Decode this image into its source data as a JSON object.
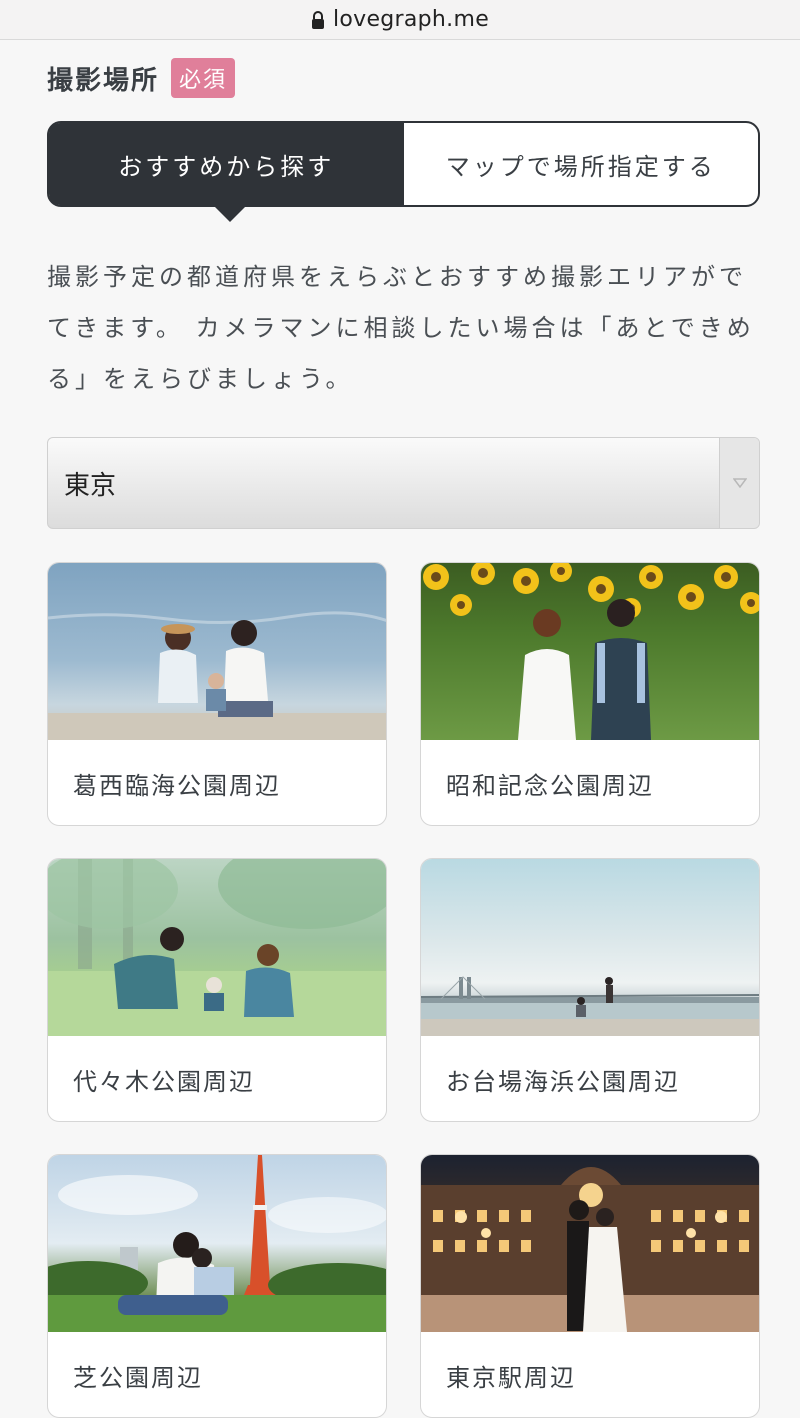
{
  "browser": {
    "url": "lovegraph.me",
    "lock_icon": "lock-icon"
  },
  "section": {
    "title": "撮影場所",
    "required_badge": "必須"
  },
  "tabs": {
    "active_label": "おすすめから探す",
    "inactive_label": "マップで場所指定する"
  },
  "description": "撮影予定の都道府県をえらぶとおすすめ撮影エリアがでてきます。 カメラマンに相談したい場合は「あとできめる」をえらびましょう。",
  "prefecture_select": {
    "selected": "東京",
    "arrow_icon": "triangle-down-icon"
  },
  "areas": [
    {
      "label": "葛西臨海公園周辺",
      "photo": "family-on-beach"
    },
    {
      "label": "昭和記念公園周辺",
      "photo": "couple-in-sunflowers"
    },
    {
      "label": "代々木公園周辺",
      "photo": "family-on-lawn"
    },
    {
      "label": "お台場海浜公園周辺",
      "photo": "couple-by-bay-bridge"
    },
    {
      "label": "芝公園周辺",
      "photo": "family-under-tokyo-tower"
    },
    {
      "label": "東京駅周辺",
      "photo": "couple-at-tokyo-station"
    }
  ]
}
